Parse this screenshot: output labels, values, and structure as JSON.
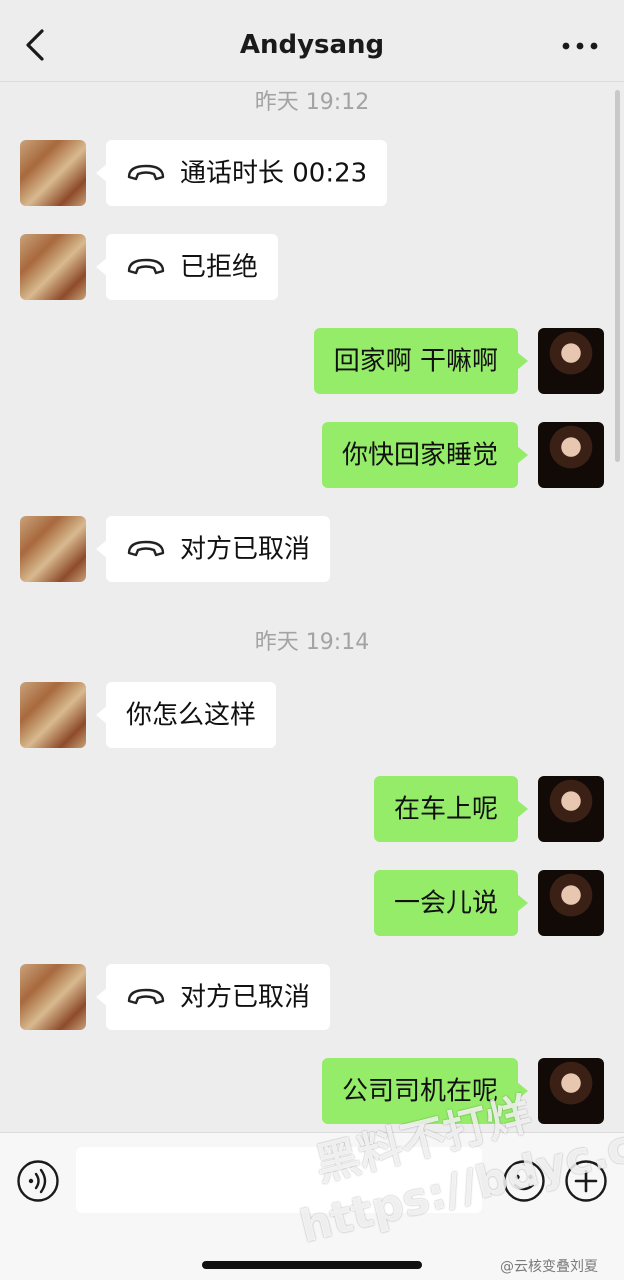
{
  "header": {
    "title": "Andysang"
  },
  "messages": [
    {
      "type": "time",
      "text": "昨天 19:12"
    },
    {
      "type": "call",
      "side": "left",
      "text": "通话时长 00:23"
    },
    {
      "type": "call",
      "side": "left",
      "text": "已拒绝"
    },
    {
      "type": "text",
      "side": "right",
      "text": "回家啊 干嘛啊"
    },
    {
      "type": "text",
      "side": "right",
      "text": "你快回家睡觉"
    },
    {
      "type": "call",
      "side": "left",
      "text": "对方已取消"
    },
    {
      "type": "time",
      "text": "昨天 19:14"
    },
    {
      "type": "text",
      "side": "left",
      "text": "你怎么这样"
    },
    {
      "type": "text",
      "side": "right",
      "text": "在车上呢"
    },
    {
      "type": "text",
      "side": "right",
      "text": "一会儿说"
    },
    {
      "type": "call",
      "side": "left",
      "text": "对方已取消"
    },
    {
      "type": "text",
      "side": "right",
      "text": "公司司机在呢"
    }
  ],
  "input": {
    "value": ""
  },
  "watermark": {
    "line1": "黑料不打烊",
    "line2": "https://bdyc.co"
  },
  "credit": "@云核变叠刘夏",
  "colors": {
    "background": "#ededed",
    "bubble_sent": "#95ec69",
    "bubble_received": "#ffffff",
    "timestamp": "#a3a3a3"
  }
}
